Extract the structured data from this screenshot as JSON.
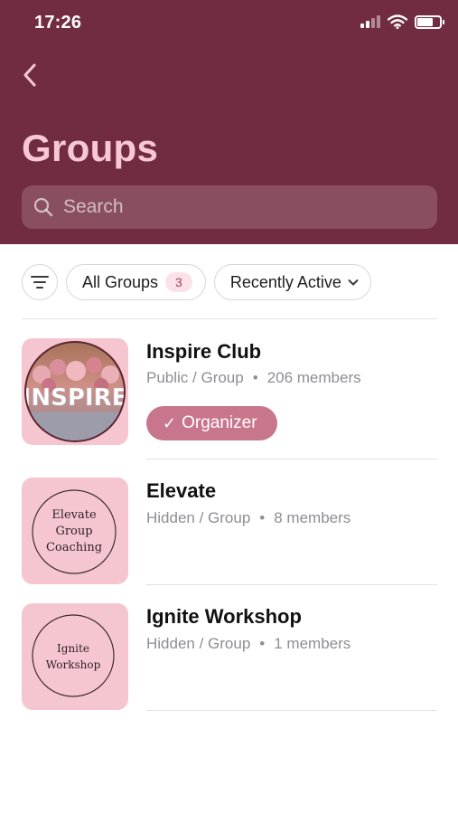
{
  "status_bar": {
    "time": "17:26"
  },
  "header": {
    "title": "Groups"
  },
  "search": {
    "placeholder": "Search"
  },
  "filters": {
    "all_groups_label": "All Groups",
    "all_groups_count": "3",
    "sort_label": "Recently Active"
  },
  "groups": [
    {
      "name": "Inspire Club",
      "visibility": "Public / Group",
      "members": "206 members",
      "badge": "Organizer",
      "thumb_text": "INSPIRE"
    },
    {
      "name": "Elevate",
      "visibility": "Hidden / Group",
      "members": "8 members",
      "thumb_lines": [
        "Elevate",
        "Group",
        "Coaching"
      ]
    },
    {
      "name": "Ignite Workshop",
      "visibility": "Hidden / Group",
      "members": "1 members",
      "thumb_lines": [
        "Ignite",
        "Workshop"
      ]
    }
  ],
  "colors": {
    "header_bg": "#722c41",
    "title_pink": "#f8c9d4",
    "thumb_pink": "#f6c6d0",
    "badge_bg": "#c8768c"
  },
  "icons": {
    "back": "chevron-left-icon",
    "search": "magnifier-icon",
    "filter": "filter-lines-icon",
    "sort": "chevron-down-icon",
    "status": [
      "cellular-signal-icon",
      "wifi-icon",
      "battery-icon"
    ]
  }
}
